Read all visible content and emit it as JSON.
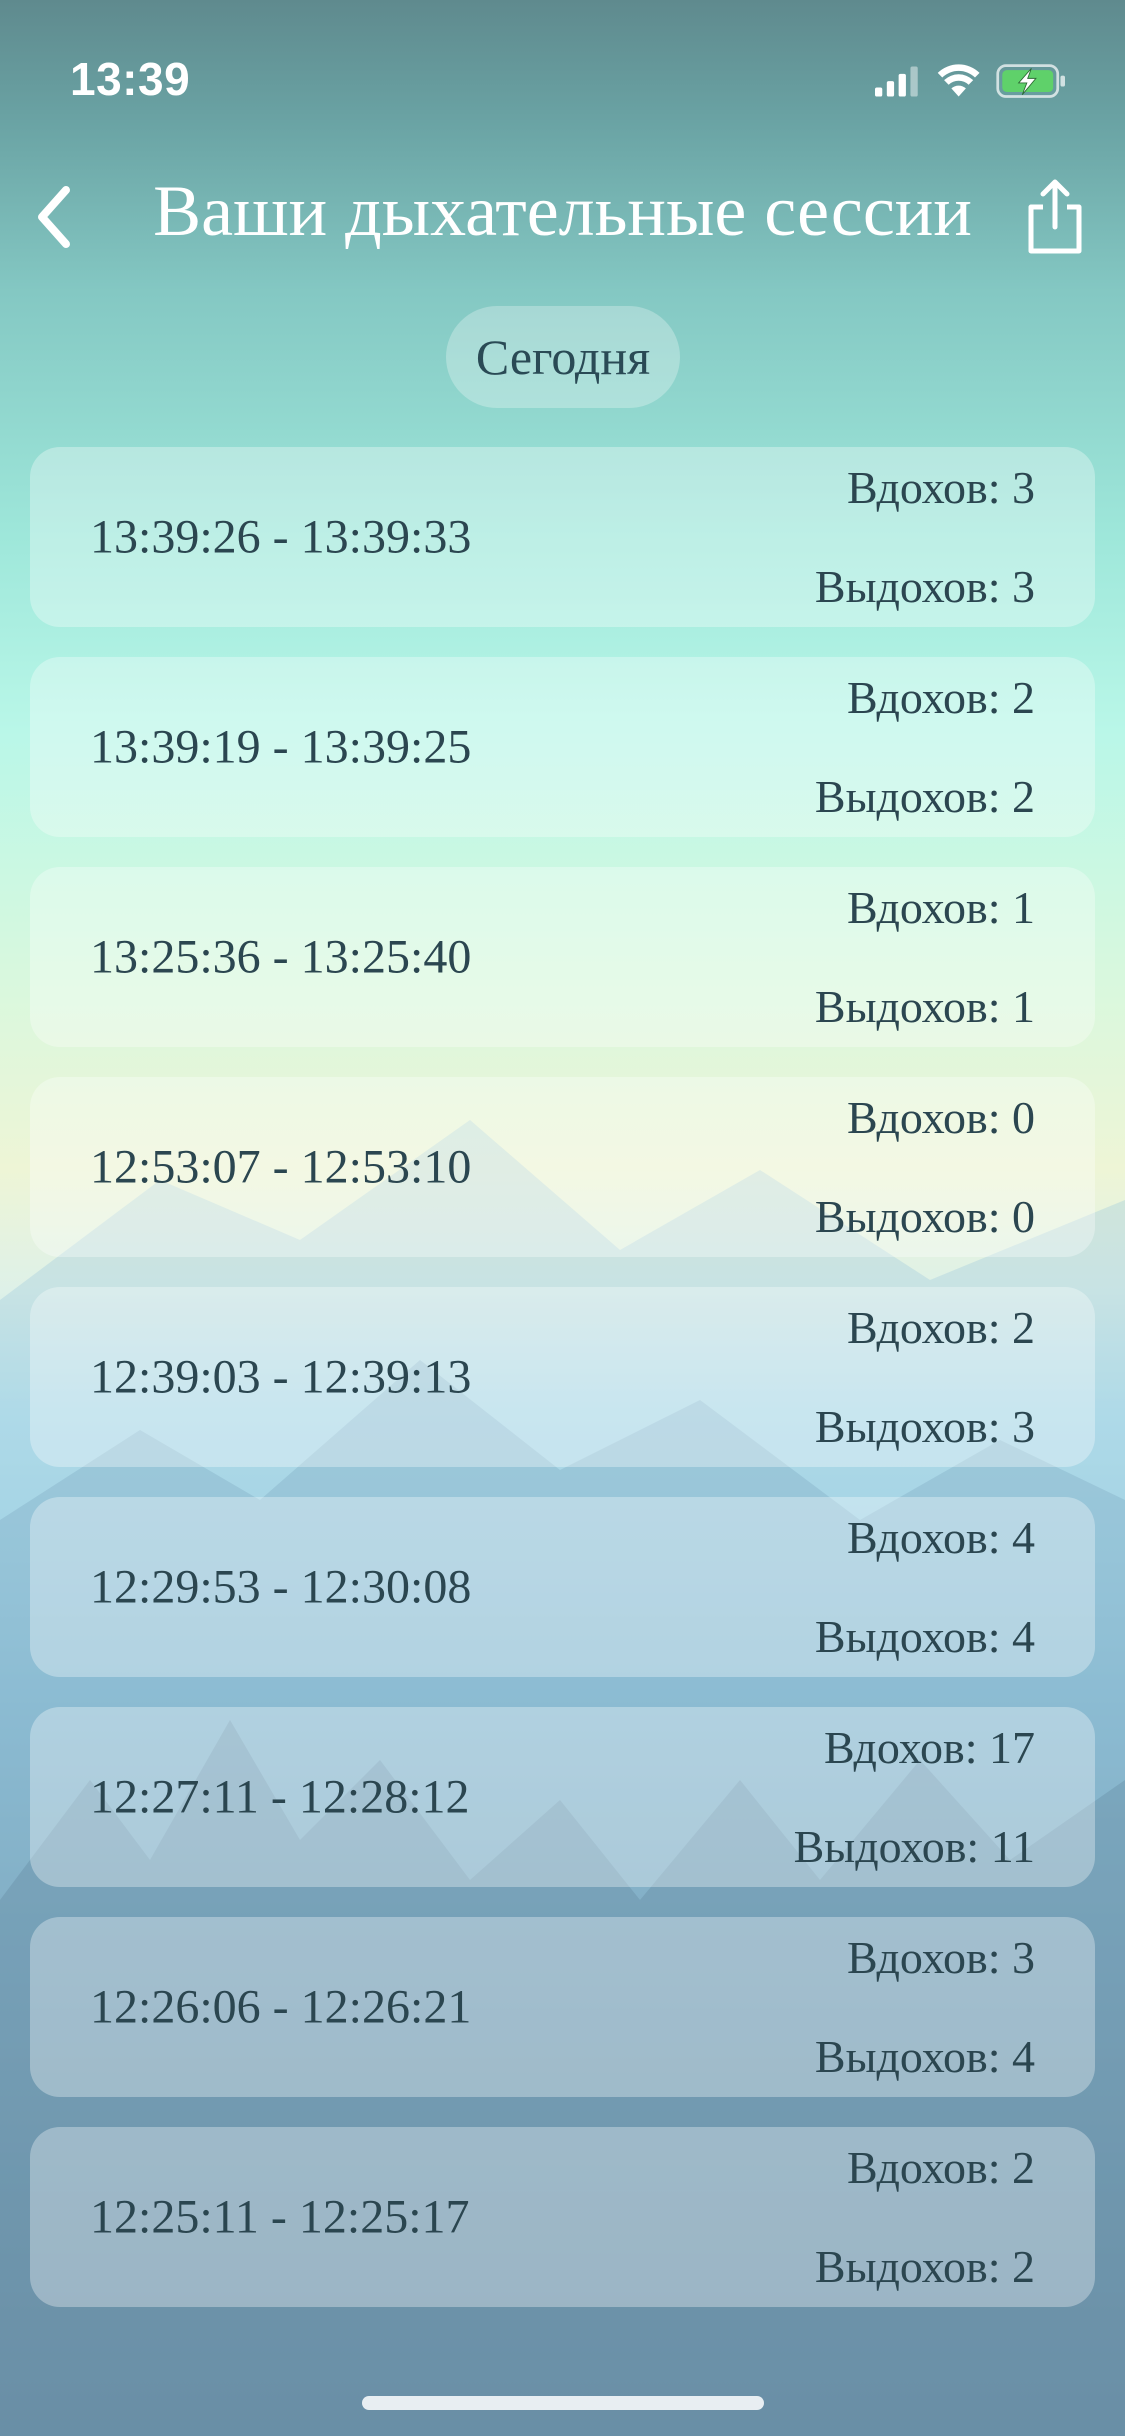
{
  "status_bar": {
    "time": "13:39",
    "icons": [
      "cellular-signal-icon",
      "wifi-icon",
      "battery-charging-icon"
    ],
    "battery_color": "#5fd16a"
  },
  "nav": {
    "title": "Ваши дыхательные сессии",
    "back_icon": "chevron-left-icon",
    "share_icon": "share-icon"
  },
  "filter": {
    "label": "Сегодня"
  },
  "sessions": [
    {
      "range": "13:39:26 - 13:39:33",
      "inhales": "Вдохов: 3",
      "exhales": "Выдохов: 3"
    },
    {
      "range": "13:39:19 - 13:39:25",
      "inhales": "Вдохов: 2",
      "exhales": "Выдохов: 2"
    },
    {
      "range": "13:25:36 - 13:25:40",
      "inhales": "Вдохов: 1",
      "exhales": "Выдохов: 1"
    },
    {
      "range": "12:53:07 - 12:53:10",
      "inhales": "Вдохов: 0",
      "exhales": "Выдохов: 0"
    },
    {
      "range": "12:39:03 - 12:39:13",
      "inhales": "Вдохов: 2",
      "exhales": "Выдохов: 3"
    },
    {
      "range": "12:29:53 - 12:30:08",
      "inhales": "Вдохов: 4",
      "exhales": "Выдохов: 4"
    },
    {
      "range": "12:27:11 - 12:28:12",
      "inhales": "Вдохов: 17",
      "exhales": "Выдохов: 11"
    },
    {
      "range": "12:26:06 - 12:26:21",
      "inhales": "Вдохов: 3",
      "exhales": "Выдохов: 4"
    },
    {
      "range": "12:25:11 - 12:25:17",
      "inhales": "Вдохов: 2",
      "exhales": "Выдохов: 2"
    }
  ]
}
